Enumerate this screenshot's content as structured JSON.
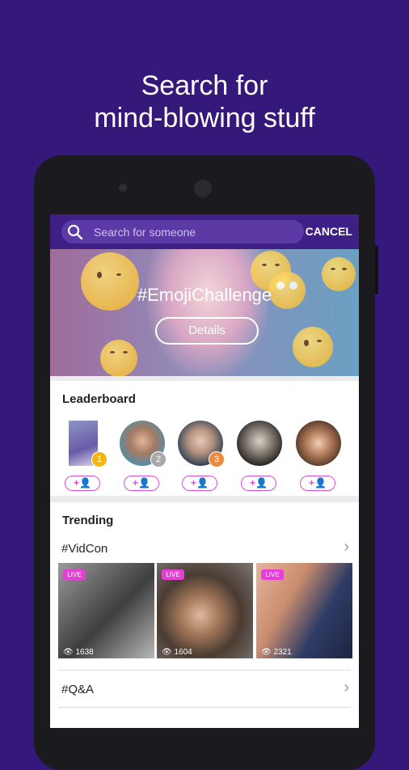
{
  "promo": {
    "line1": "Search for",
    "line2": "mind-blowing stuff"
  },
  "search": {
    "placeholder": "Search for someone",
    "cancel_label": "CANCEL"
  },
  "banner": {
    "hashtag": "#EmojiChallenge",
    "details_label": "Details"
  },
  "leaderboard": {
    "title": "Leaderboard",
    "follow_label": "+👤",
    "users": [
      {
        "rank": "1",
        "rank_color": "#f2b713"
      },
      {
        "rank": "2",
        "rank_color": "#a9a9a9"
      },
      {
        "rank": "3",
        "rank_color": "#ef8a3c"
      },
      {
        "rank": "",
        "rank_color": ""
      },
      {
        "rank": "",
        "rank_color": ""
      }
    ]
  },
  "trending": {
    "title": "Trending",
    "topics": [
      {
        "label": "#VidCon",
        "streams": [
          {
            "live": "LIVE",
            "views": "1638"
          },
          {
            "live": "LIVE",
            "views": "1604"
          },
          {
            "live": "LIVE",
            "views": "2321"
          }
        ]
      },
      {
        "label": "#Q&A"
      }
    ]
  },
  "colors": {
    "brand_purple": "#35197a",
    "live_pink": "#e63fd6",
    "accent": "#d64fd4"
  }
}
